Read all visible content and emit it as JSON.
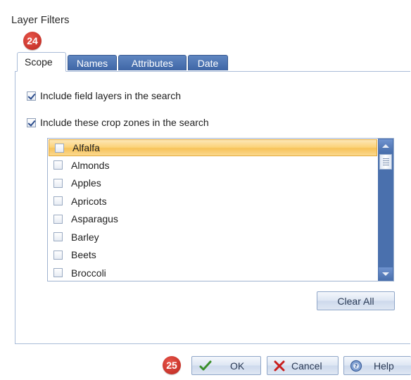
{
  "window": {
    "title": "Layer Filters"
  },
  "badges": {
    "tabs_callout": "24",
    "buttons_callout": "25"
  },
  "tabs": [
    {
      "label": "Scope",
      "active": true
    },
    {
      "label": "Names",
      "active": false
    },
    {
      "label": "Attributes",
      "active": false
    },
    {
      "label": "Date",
      "active": false
    }
  ],
  "scope": {
    "include_field_layers": {
      "label": "Include field layers in the search",
      "checked": true
    },
    "include_crop_zones": {
      "label": "Include these crop zones in the search",
      "checked": true
    },
    "crop_zones": [
      {
        "label": "Alfalfa",
        "checked": false,
        "selected": true
      },
      {
        "label": "Almonds",
        "checked": false,
        "selected": false
      },
      {
        "label": "Apples",
        "checked": false,
        "selected": false
      },
      {
        "label": "Apricots",
        "checked": false,
        "selected": false
      },
      {
        "label": "Asparagus",
        "checked": false,
        "selected": false
      },
      {
        "label": "Barley",
        "checked": false,
        "selected": false
      },
      {
        "label": "Beets",
        "checked": false,
        "selected": false
      },
      {
        "label": "Broccoli",
        "checked": false,
        "selected": false
      }
    ],
    "clear_all_label": "Clear All"
  },
  "footer": {
    "ok_label": "OK",
    "cancel_label": "Cancel",
    "help_label": "Help"
  },
  "icons": {
    "ok": "checkmark-icon",
    "cancel": "x-icon",
    "help": "help-icon"
  },
  "colors": {
    "tab_blue": "#4a70ad",
    "selection": "#fbd47c",
    "badge": "#c8342b",
    "ok_check": "#3a8f2a",
    "cancel_x": "#c81e1e"
  }
}
